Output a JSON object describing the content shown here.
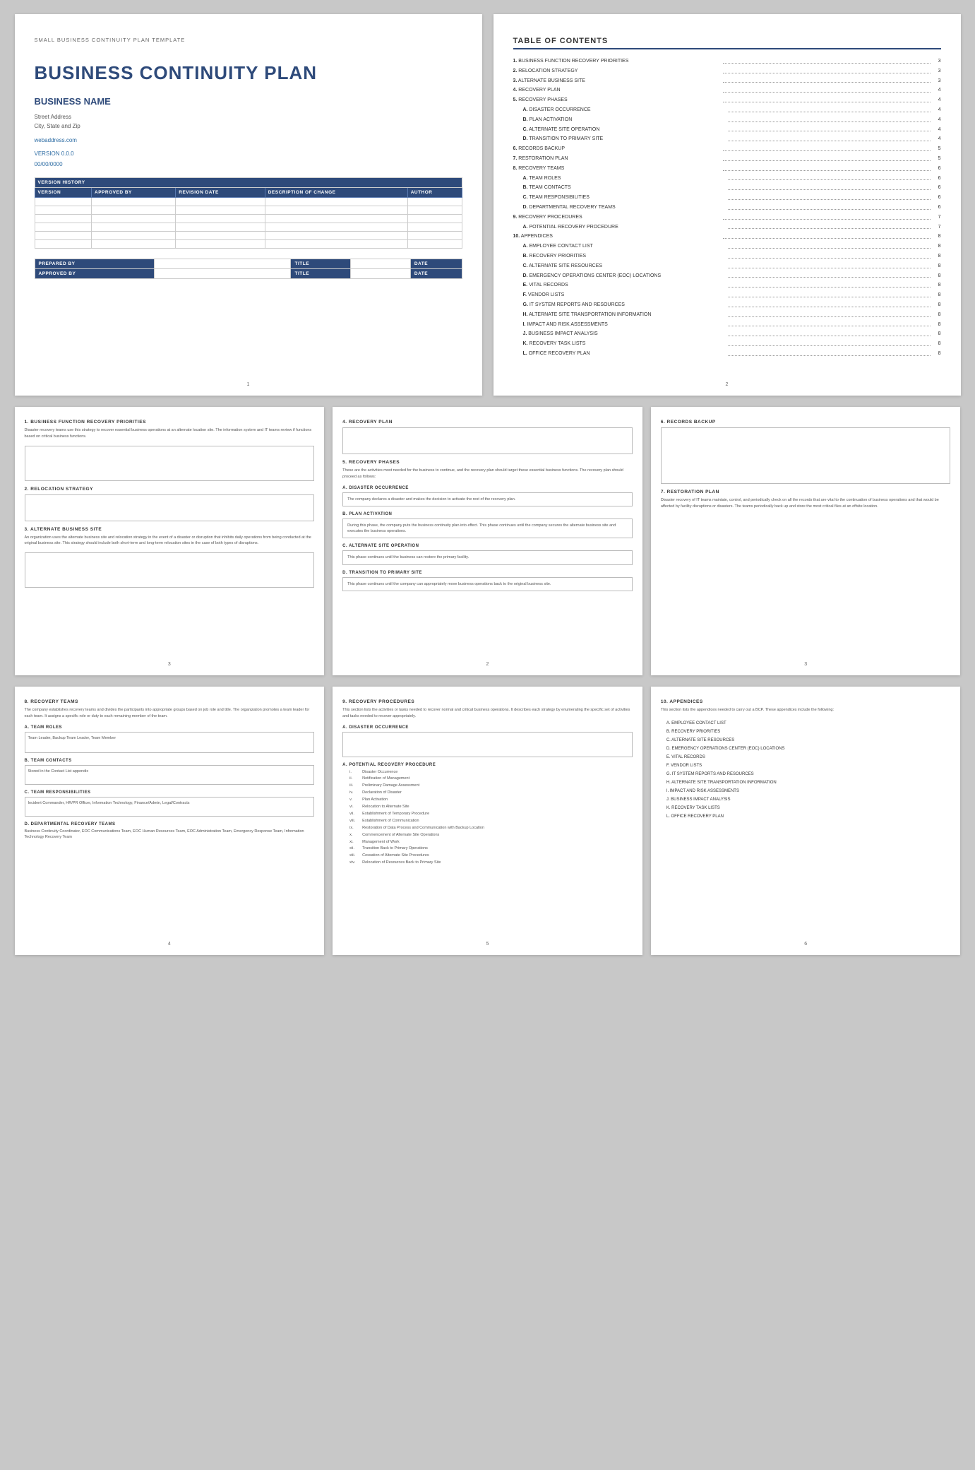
{
  "doc": {
    "subtitle": "SMALL BUSINESS CONTINUITY PLAN TEMPLATE",
    "title": "BUSINESS CONTINUITY PLAN",
    "biz_name": "BUSINESS NAME",
    "address_line1": "Street Address",
    "address_line2": "City, State and Zip",
    "website": "webaddress.com",
    "version": "VERSION 0.0.0",
    "date": "00/00/0000"
  },
  "version_table": {
    "header": "VERSION HISTORY",
    "columns": [
      "VERSION",
      "APPROVED BY",
      "REVISION DATE",
      "DESCRIPTION OF CHANGE",
      "AUTHOR"
    ],
    "rows": 6
  },
  "prepared": {
    "prepared_label": "PREPARED BY",
    "title_label": "TITLE",
    "date_label": "DATE",
    "approved_label": "APPROVED BY"
  },
  "toc": {
    "title": "TABLE OF CONTENTS",
    "items": [
      {
        "num": "1.",
        "label": "BUSINESS FUNCTION RECOVERY PRIORITIES",
        "page": "3",
        "indent": false
      },
      {
        "num": "2.",
        "label": "RELOCATION STRATEGY",
        "page": "3",
        "indent": false
      },
      {
        "num": "3.",
        "label": "ALTERNATE BUSINESS SITE",
        "page": "3",
        "indent": false
      },
      {
        "num": "4.",
        "label": "RECOVERY PLAN",
        "page": "4",
        "indent": false
      },
      {
        "num": "5.",
        "label": "RECOVERY PHASES",
        "page": "4",
        "indent": false
      },
      {
        "num": "A.",
        "label": "DISASTER OCCURRENCE",
        "page": "4",
        "indent": true
      },
      {
        "num": "B.",
        "label": "PLAN ACTIVATION",
        "page": "4",
        "indent": true
      },
      {
        "num": "C.",
        "label": "ALTERNATE SITE OPERATION",
        "page": "4",
        "indent": true
      },
      {
        "num": "D.",
        "label": "TRANSITION TO PRIMARY SITE",
        "page": "4",
        "indent": true
      },
      {
        "num": "6.",
        "label": "RECORDS BACKUP",
        "page": "5",
        "indent": false
      },
      {
        "num": "7.",
        "label": "RESTORATION PLAN",
        "page": "5",
        "indent": false
      },
      {
        "num": "8.",
        "label": "RECOVERY TEAMS",
        "page": "6",
        "indent": false
      },
      {
        "num": "A.",
        "label": "TEAM ROLES",
        "page": "6",
        "indent": true
      },
      {
        "num": "B.",
        "label": "TEAM CONTACTS",
        "page": "6",
        "indent": true
      },
      {
        "num": "C.",
        "label": "TEAM RESPONSIBILITIES",
        "page": "6",
        "indent": true
      },
      {
        "num": "D.",
        "label": "DEPARTMENTAL RECOVERY TEAMS",
        "page": "6",
        "indent": true
      },
      {
        "num": "9.",
        "label": "RECOVERY PROCEDURES",
        "page": "7",
        "indent": false
      },
      {
        "num": "A.",
        "label": "POTENTIAL RECOVERY PROCEDURE",
        "page": "7",
        "indent": true
      },
      {
        "num": "10.",
        "label": "APPENDICES",
        "page": "8",
        "indent": false
      },
      {
        "num": "A.",
        "label": "EMPLOYEE CONTACT LIST",
        "page": "8",
        "indent": true
      },
      {
        "num": "B.",
        "label": "RECOVERY PRIORITIES",
        "page": "8",
        "indent": true
      },
      {
        "num": "C.",
        "label": "ALTERNATE SITE RESOURCES",
        "page": "8",
        "indent": true
      },
      {
        "num": "D.",
        "label": "EMERGENCY OPERATIONS CENTER (EOC) LOCATIONS",
        "page": "8",
        "indent": true
      },
      {
        "num": "E.",
        "label": "VITAL RECORDS",
        "page": "8",
        "indent": true
      },
      {
        "num": "F.",
        "label": "VENDOR LISTS",
        "page": "8",
        "indent": true
      },
      {
        "num": "G.",
        "label": "IT SYSTEM REPORTS AND RESOURCES",
        "page": "8",
        "indent": true
      },
      {
        "num": "H.",
        "label": "ALTERNATE SITE TRANSPORTATION INFORMATION",
        "page": "8",
        "indent": true
      },
      {
        "num": "I.",
        "label": "IMPACT AND RISK ASSESSMENTS",
        "page": "8",
        "indent": true
      },
      {
        "num": "J.",
        "label": "BUSINESS IMPACT ANALYSIS",
        "page": "8",
        "indent": true
      },
      {
        "num": "K.",
        "label": "RECOVERY TASK LISTS",
        "page": "8",
        "indent": true
      },
      {
        "num": "L.",
        "label": "OFFICE RECOVERY PLAN",
        "page": "8",
        "indent": true
      }
    ]
  },
  "page3": {
    "s1_heading": "1. BUSINESS FUNCTION RECOVERY PRIORITIES",
    "s1_body": "Disaster recovery teams use this strategy to recover essential business operations at an alternate location site. The information system and IT teams review if functions based on critical business functions.",
    "s2_heading": "2. RELOCATION STRATEGY",
    "s3_heading": "3. ALTERNATE BUSINESS SITE",
    "s3_body": "An organization uses the alternate business site and relocation strategy in the event of a disaster or disruption that inhibits daily operations from being conducted at the original business site. This strategy should include both short-term and long-term relocation sites in the case of both types of disruptions.",
    "page_num": "3"
  },
  "page4": {
    "s4_heading": "4. RECOVERY PLAN",
    "s5_heading": "5. RECOVERY PHASES",
    "s5_body": "These are the activities most needed for the business to continue, and the recovery plan should target these essential business functions. The recovery plan should proceed as follows:",
    "phaseA_heading": "A. DISASTER OCCURRENCE",
    "phaseA_body": "The company declares a disaster and makes the decision to activate the rest of the recovery plan.",
    "phaseB_heading": "B. PLAN ACTIVATION",
    "phaseB_body": "During this phase, the company puts the business continuity plan into effect. This phase continues until the company secures the alternate business site and executes the business operations.",
    "phaseC_heading": "C. ALTERNATE SITE OPERATION",
    "phaseC_body": "This phase continues until the business can restore the primary facility.",
    "phaseD_heading": "D. TRANSITION TO PRIMARY SITE",
    "phaseD_body": "This phase continues until the company can appropriately move business operations back to the original business site.",
    "page_num": "2"
  },
  "page5": {
    "s6_heading": "6. RECORDS BACKUP",
    "s7_heading": "7. RESTORATION PLAN",
    "s7_body": "Disaster recovery of IT teams maintain, control, and periodically check on all the records that are vital to the continuation of business operations and that would be affected by facility disruptions or disasters. The teams periodically back up and store the most critical files at an offsite location.",
    "page_num": "3"
  },
  "page6": {
    "s8_heading": "8. RECOVERY TEAMS",
    "s8_body": "The company establishes recovery teams and divides the participants into appropriate groups based on job role and title. The organization promotes a team leader for each team. It assigns a specific role or duty to each remaining member of the team.",
    "teamA_heading": "A. TEAM ROLES",
    "teamA_body": "Team Leader, Backup Team Leader, Team Member",
    "teamB_heading": "B. TEAM CONTACTS",
    "teamB_body": "Stored in the Contact List appendix",
    "teamC_heading": "C. TEAM RESPONSIBILITIES",
    "teamC_body": "Incident Commander, HR/PR Officer, Information Technology, Finance/Admin, Legal/Contracts",
    "teamD_heading": "D. DEPARTMENTAL RECOVERY TEAMS",
    "teamD_body": "Business Continuity Coordinator, EOC Communications Team, EOC Human Resources Team, EOC Administration Team, Emergency Response Team, Information Technology Recovery Team",
    "page_num": "4"
  },
  "page7": {
    "s9_heading": "9. RECOVERY PROCEDURES",
    "s9_body": "This section lists the activities or tasks needed to recover normal and critical business operations. It describes each strategy by enumerating the specific set of activities and tasks needed to recover appropriately.",
    "phaseA_heading": "A. DISASTER OCCURRENCE",
    "phaseA_sub": "A. POTENTIAL RECOVERY PROCEDURE",
    "procedures": [
      {
        "num": "i.",
        "text": "Disaster Occurrence"
      },
      {
        "num": "ii.",
        "text": "Notification of Management"
      },
      {
        "num": "iii.",
        "text": "Preliminary Damage Assessment"
      },
      {
        "num": "iv.",
        "text": "Declaration of Disaster"
      },
      {
        "num": "v.",
        "text": "Plan Activation"
      },
      {
        "num": "vi.",
        "text": "Relocation to Alternate Site"
      },
      {
        "num": "vii.",
        "text": "Establishment of Temporary Procedure"
      },
      {
        "num": "viii.",
        "text": "Establishment of Communication"
      },
      {
        "num": "ix.",
        "text": "Restoration of Data Process and Communication with Backup Location"
      },
      {
        "num": "x.",
        "text": "Commencement of Alternate Site Operations"
      },
      {
        "num": "xi.",
        "text": "Management of Work"
      },
      {
        "num": "xii.",
        "text": "Transition Back to Primary Operations"
      },
      {
        "num": "xiii.",
        "text": "Cessation of Alternate Site Procedures"
      },
      {
        "num": "xiv.",
        "text": "Relocation of Resources Back to Primary Site"
      }
    ],
    "page_num": "5"
  },
  "page8": {
    "s10_heading": "10. APPENDICES",
    "s10_body": "This section lists the appendices needed to carry out a BCP. These appendices include the following:",
    "appendices": [
      "A. EMPLOYEE CONTACT LIST",
      "B. RECOVERY PRIORITIES",
      "C. ALTERNATE SITE RESOURCES",
      "D. EMERGENCY OPERATIONS CENTER (EOC) LOCATIONS",
      "E. VITAL RECORDS",
      "F. VENDOR LISTS",
      "G. IT SYSTEM REPORTS AND RESOURCES",
      "H. ALTERNATE SITE TRANSPORTATION INFORMATION",
      "I. IMPACT AND RISK ASSESSMENTS",
      "J. BUSINESS IMPACT ANALYSIS",
      "K. RECOVERY TASK LISTS",
      "L. OFFICE RECOVERY PLAN"
    ],
    "page_num": "6"
  }
}
